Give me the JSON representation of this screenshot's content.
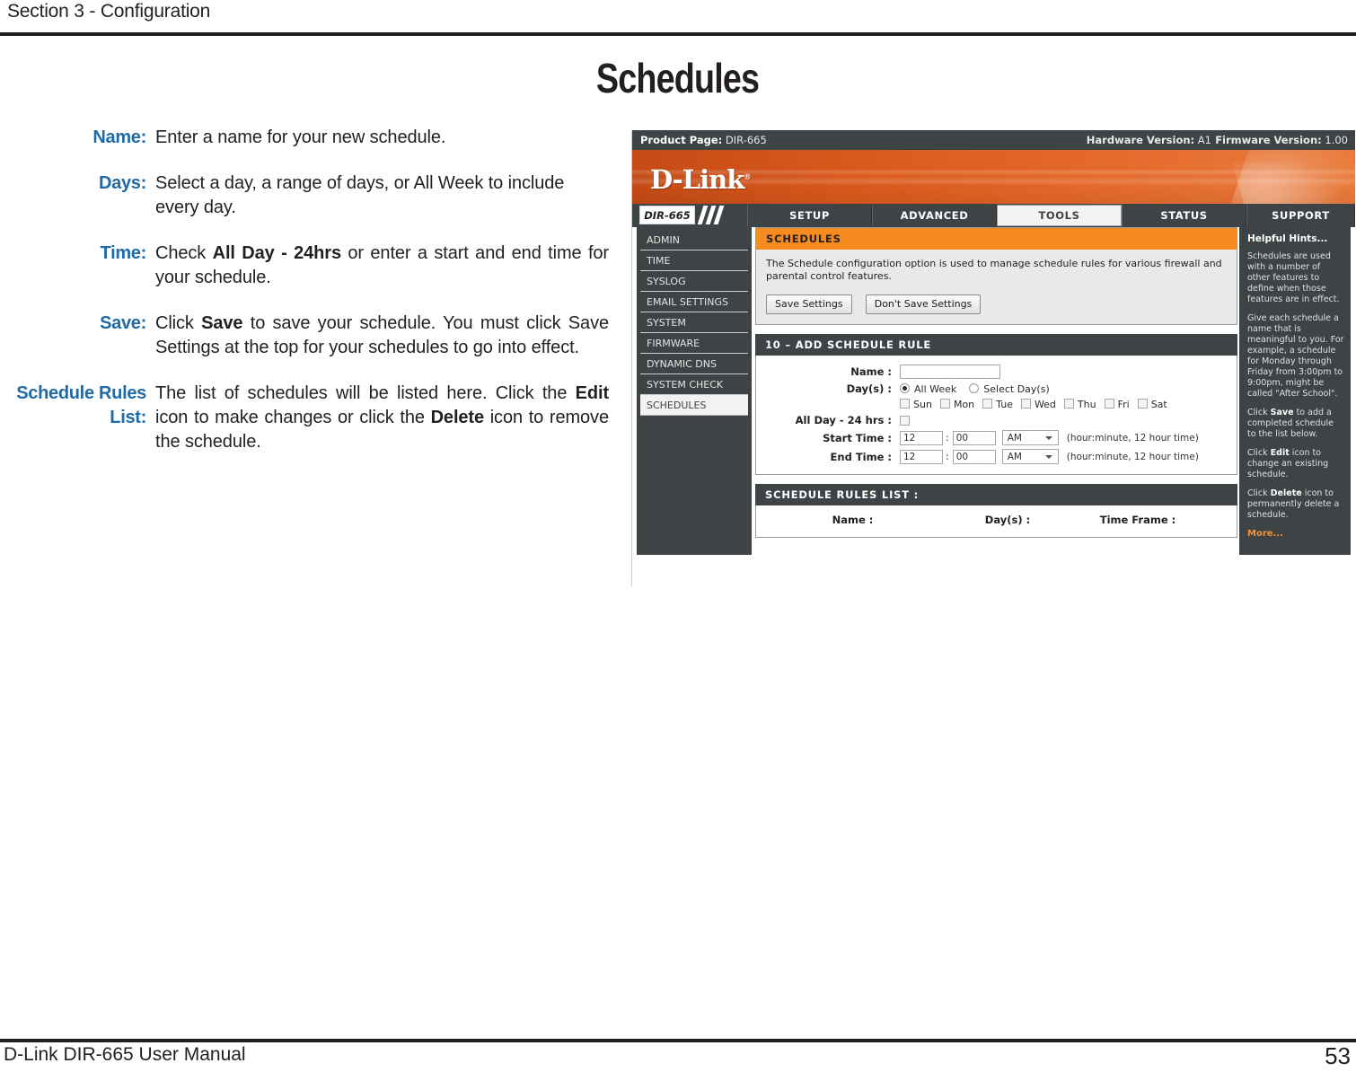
{
  "page": {
    "section_header": "Section 3 - Configuration",
    "title": "Schedules",
    "footer_manual": "D-Link DIR-665 User Manual",
    "footer_page": "53"
  },
  "descriptions": [
    {
      "label": "Name:",
      "text": "Enter a name for your new schedule."
    },
    {
      "label": "Days:",
      "text": "Select a day, a range of days, or All Week to include every day."
    },
    {
      "label": "Time:",
      "text_a": "Check ",
      "bold_a": "All Day - 24hrs",
      "text_b": " or enter a start and end time for your schedule."
    },
    {
      "label": "Save:",
      "text_a": "Click ",
      "bold_a": "Save",
      "text_b": " to save your schedule. You must click Save Settings at the top for your schedules to go into effect."
    },
    {
      "label_line1": "Schedule Rules",
      "label_line2": "List:",
      "text_a": "The list of schedules will be listed here. Click the ",
      "bold_a": "Edit",
      "text_b": " icon to make changes or click the ",
      "bold_b": "Delete",
      "text_c": " icon to remove the schedule."
    }
  ],
  "router_ui": {
    "topbar": {
      "product_page_label": "Product Page:",
      "product_page_value": " DIR-665",
      "hardware_version_label": "Hardware Version:",
      "hardware_version_value": " A1",
      "firmware_version_label": "Firmware Version:",
      "firmware_version_value": " 1.00"
    },
    "brand": "D-Link",
    "model_badge": "DIR-665",
    "tabs": [
      {
        "label": "SETUP",
        "active": false
      },
      {
        "label": "ADVANCED",
        "active": false
      },
      {
        "label": "TOOLS",
        "active": true
      },
      {
        "label": "STATUS",
        "active": false
      },
      {
        "label": "SUPPORT",
        "active": false
      }
    ],
    "sidebar": [
      {
        "label": "ADMIN",
        "active": false
      },
      {
        "label": "TIME",
        "active": false
      },
      {
        "label": "SYSLOG",
        "active": false
      },
      {
        "label": "EMAIL SETTINGS",
        "active": false
      },
      {
        "label": "SYSTEM",
        "active": false
      },
      {
        "label": "FIRMWARE",
        "active": false
      },
      {
        "label": "DYNAMIC DNS",
        "active": false
      },
      {
        "label": "SYSTEM CHECK",
        "active": false
      },
      {
        "label": "SCHEDULES",
        "active": true
      }
    ],
    "schedules_panel": {
      "heading": "SCHEDULES",
      "description": "The Schedule configuration option is used to manage schedule rules for various firewall and parental control features.",
      "save_button": "Save Settings",
      "dont_save_button": "Don't Save Settings"
    },
    "add_rule_panel": {
      "heading": "10 – ADD SCHEDULE RULE",
      "name_label": "Name :",
      "name_value": "",
      "days_label": "Day(s) :",
      "all_week_option": "All Week",
      "select_days_option": "Select Day(s)",
      "all_week_selected": true,
      "days": [
        {
          "label": "Sun",
          "checked": false
        },
        {
          "label": "Mon",
          "checked": false
        },
        {
          "label": "Tue",
          "checked": false
        },
        {
          "label": "Wed",
          "checked": false
        },
        {
          "label": "Thu",
          "checked": false
        },
        {
          "label": "Fri",
          "checked": false
        },
        {
          "label": "Sat",
          "checked": false
        }
      ],
      "all_day_label": "All Day - 24 hrs :",
      "all_day_checked": false,
      "start_time_label": "Start Time :",
      "start_hour": "12",
      "start_minute": "00",
      "start_meridiem": "AM",
      "start_hint": "(hour:minute, 12 hour time)",
      "end_time_label": "End Time :",
      "end_hour": "12",
      "end_minute": "00",
      "end_meridiem": "AM",
      "end_hint": "(hour:minute, 12 hour time)",
      "time_separator": ":"
    },
    "rules_list_panel": {
      "heading": "SCHEDULE RULES LIST :",
      "col_name": "Name :",
      "col_days": "Day(s) :",
      "col_timeframe": "Time Frame :"
    },
    "helpful_hints": {
      "title": "Helpful Hints...",
      "p1": "Schedules are used with a number of other features to define when those features are in effect.",
      "p2": "Give each schedule a name that is meaningful to you. For example, a schedule for Monday through Friday from 3:00pm to 9:00pm, might be called \"After School\".",
      "p3_a": "Click ",
      "p3_b": "Save",
      "p3_c": " to add a completed schedule to the list below.",
      "p4_a": "Click ",
      "p4_b": "Edit",
      "p4_c": " icon to change an existing schedule.",
      "p5_a": "Click ",
      "p5_b": "Delete",
      "p5_c": " icon to permanently delete a schedule.",
      "more": "More..."
    }
  },
  "colors": {
    "accent_blue": "#1e6ba8",
    "dlink_orange": "#f68b1f",
    "dark_gray": "#3e4345",
    "hint_more": "#f0933a"
  }
}
